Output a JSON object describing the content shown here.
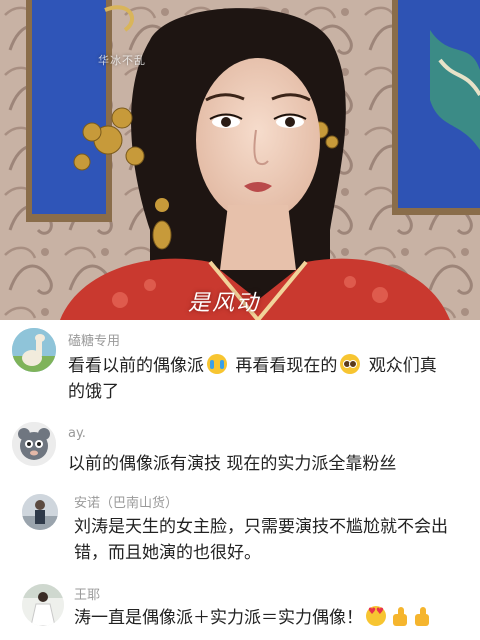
{
  "video": {
    "watermark_top": "华冰不乱",
    "watermark_bottom": "是风动"
  },
  "comments": [
    {
      "username": "磕糖专用",
      "avatar_icon": "llama-avatar",
      "line1_a": "看看以前的偶像派",
      "emoji1": "crying-face-icon",
      "line1_b": " 再看看现在的",
      "emoji2": "pleading-face-icon",
      "line1_c": " 观众们真",
      "line2": "的饿了"
    },
    {
      "username": "ay.",
      "avatar_icon": "cartoon-animal-avatar",
      "line1": "以前的偶像派有演技  现在的实力派全靠粉丝"
    },
    {
      "username": "安诺（巴南山货）",
      "avatar_icon": "person-photo-avatar",
      "line1": "刘涛是天生的女主脸，只需要演技不尴尬就不会出",
      "line2": "错，而且她演的也很好。"
    },
    {
      "username": "王耶",
      "avatar_icon": "person-white-dress-avatar",
      "line1": "涛一直是偶像派＋实力派＝实力偶像！",
      "emoji1": "heart-eyes-icon",
      "emoji2": "thumbs-up-icon",
      "emoji3": "thumbs-up-icon"
    }
  ]
}
